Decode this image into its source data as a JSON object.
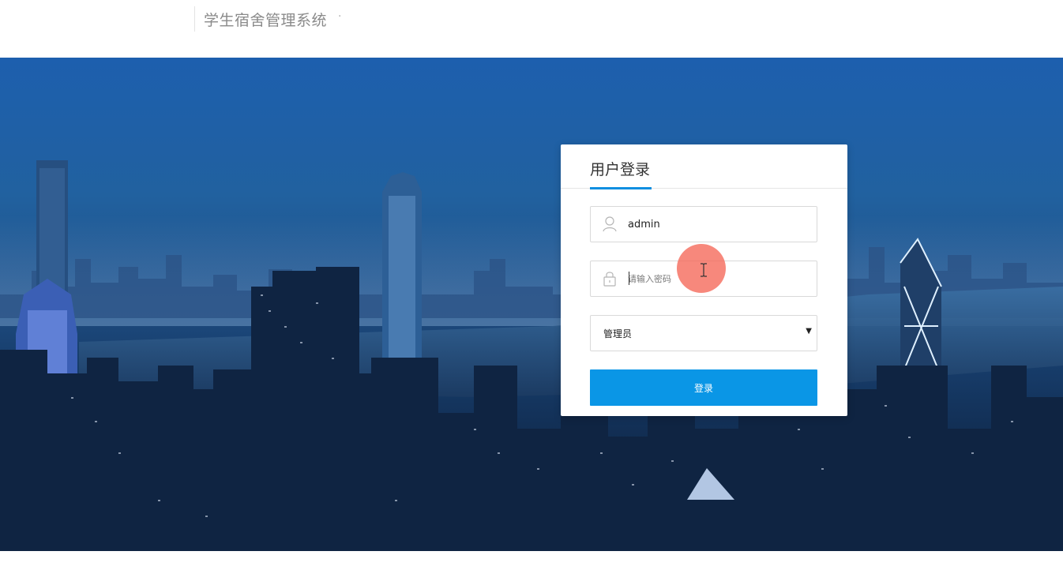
{
  "header": {
    "title": "学生宿舍管理系统",
    "title_suffix": "·"
  },
  "login": {
    "title": "用户登录",
    "username_value": "admin",
    "password_placeholder": "请输入密码",
    "role_selected": "管理员",
    "role_arrow": "▼",
    "submit_label": "登录"
  },
  "colors": {
    "accent": "#0a96e6",
    "background_sky": "#1d5fae",
    "cursor_highlight": "#f56e5f"
  },
  "icons": {
    "username": "user-icon",
    "password": "lock-icon",
    "role": "chevron-down-icon"
  }
}
